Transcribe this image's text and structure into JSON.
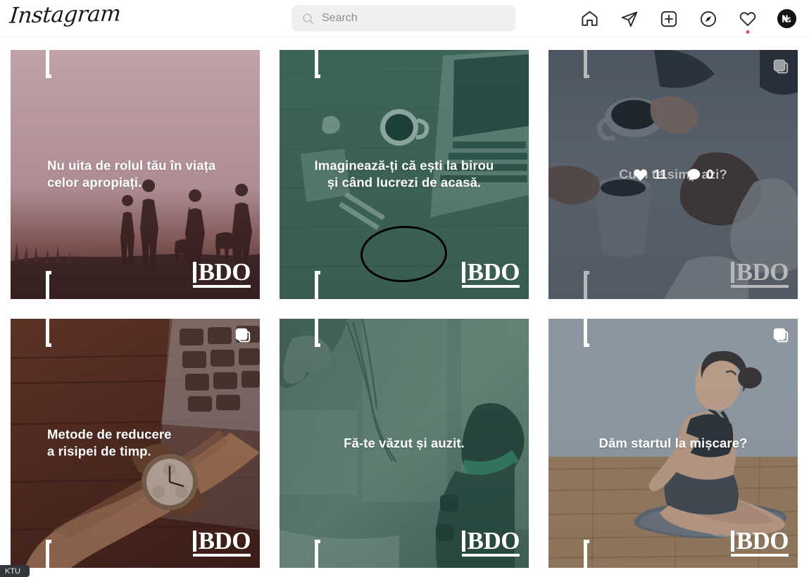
{
  "app": {
    "name": "Instagram",
    "logo_text": "Instagram"
  },
  "search": {
    "placeholder": "Search",
    "value": "",
    "icon": "search-icon"
  },
  "nav": {
    "items": [
      {
        "icon": "home-icon",
        "label": "Home"
      },
      {
        "icon": "direct-messages-icon",
        "label": "Messages"
      },
      {
        "icon": "new-post-icon",
        "label": "New post"
      },
      {
        "icon": "explore-compass-icon",
        "label": "Explore"
      },
      {
        "icon": "activity-heart-icon",
        "label": "Notifications",
        "badge": true
      },
      {
        "icon": "profile-avatar-icon",
        "label": "Profile"
      }
    ]
  },
  "colors": {
    "accent_notification": "#ed4956",
    "header_border": "#efefef",
    "search_background": "#efefef",
    "placeholder_text": "#8e8e8e",
    "page_background": "#ffffff",
    "brand_watermark": "#ffffff"
  },
  "brand": {
    "watermark": "BDO"
  },
  "grid": {
    "posts": [
      {
        "id": "post-1",
        "caption": "Nu uita de rolul tău în viața\ncelor apropiați.",
        "caption_align": "left",
        "tint": "#bc9ca3",
        "theme": "dusty-pink",
        "alt": "Silhouettes of people walking with dogs at dusk",
        "is_carousel": false,
        "hovered": false,
        "likes": null,
        "comments": null,
        "watermark": "BDO"
      },
      {
        "id": "post-2",
        "caption": "Imaginează-ți că ești la birou\nși când lucrezi de acasă.",
        "caption_align": "center",
        "tint": "#3f6157",
        "theme": "forest-green",
        "alt": "Desk flat lay with coffee cup, notepad, pencils and laptop",
        "is_carousel": false,
        "hovered": false,
        "likes": null,
        "comments": null,
        "annotation": "hand-drawn-ellipse",
        "watermark": "BDO"
      },
      {
        "id": "post-3",
        "caption": "Cum te simți azi?",
        "caption_align": "center",
        "tint": "#5d6b7a",
        "theme": "cool-blue-grey",
        "alt": "Hands holding ceramic mugs on a table during a conversation",
        "is_carousel": true,
        "hovered": true,
        "likes": "11",
        "comments": "0",
        "watermark": "BDO"
      },
      {
        "id": "post-4",
        "caption": "Metode de reducere\na risipei de timp.",
        "caption_align": "left",
        "tint": "#6b3a2c",
        "theme": "warm-sepia",
        "alt": "Arm with wristwatch resting beside a laptop on a wooden desk",
        "is_carousel": true,
        "hovered": false,
        "likes": null,
        "comments": null,
        "watermark": "BDO"
      },
      {
        "id": "post-5",
        "caption": "Fă-te văzut și auzit.",
        "caption_align": "center",
        "tint": "#4a6b5f",
        "theme": "teal-green",
        "alt": "Woman speaking into a studio microphone by a window",
        "is_carousel": false,
        "hovered": false,
        "likes": null,
        "comments": null,
        "watermark": "BDO"
      },
      {
        "id": "post-6",
        "caption": "Dăm startul la mișcare?",
        "caption_align": "center",
        "tint": "#6b7783",
        "theme": "neutral-grey",
        "alt": "Woman sitting cross-legged on a yoga mat in a bright studio",
        "is_carousel": true,
        "hovered": false,
        "likes": null,
        "comments": null,
        "watermark": "BDO"
      }
    ]
  },
  "statusbar": {
    "tooltip_fragment": "KTU"
  }
}
